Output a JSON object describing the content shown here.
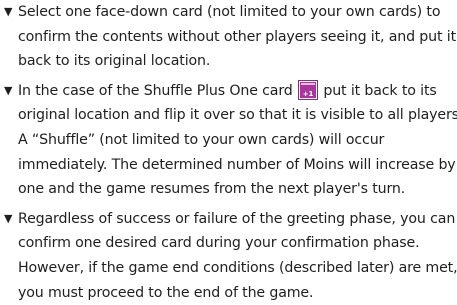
{
  "bullet_symbol": "▼",
  "paragraphs": [
    {
      "lines": [
        "Select one face-down card (not limited to your own cards) to",
        "confirm the contents without other players seeing it, and put it",
        "back to its original location."
      ]
    },
    {
      "line1_before_icon": "In the case of the Shuffle Plus One card ",
      "icon": {
        "name": "shuffle-plus-one-card-icon",
        "glyph": "+1",
        "color": "#a7379d"
      },
      "line1_after_icon": " put it back to its",
      "lines_rest": [
        "original location and flip it over so that it is visible to all players.",
        "A “Shuffle” (not limited to your own cards) will occur",
        "immediately. The determined number of Moins will increase by",
        "one and the game resumes from the next player's turn."
      ]
    },
    {
      "lines": [
        "Regardless of success or failure of the greeting phase, you can",
        "confirm one desired card during your confirmation phase.",
        "However, if the game end conditions (described later) are met,",
        "you must proceed to the end of the game."
      ]
    }
  ]
}
